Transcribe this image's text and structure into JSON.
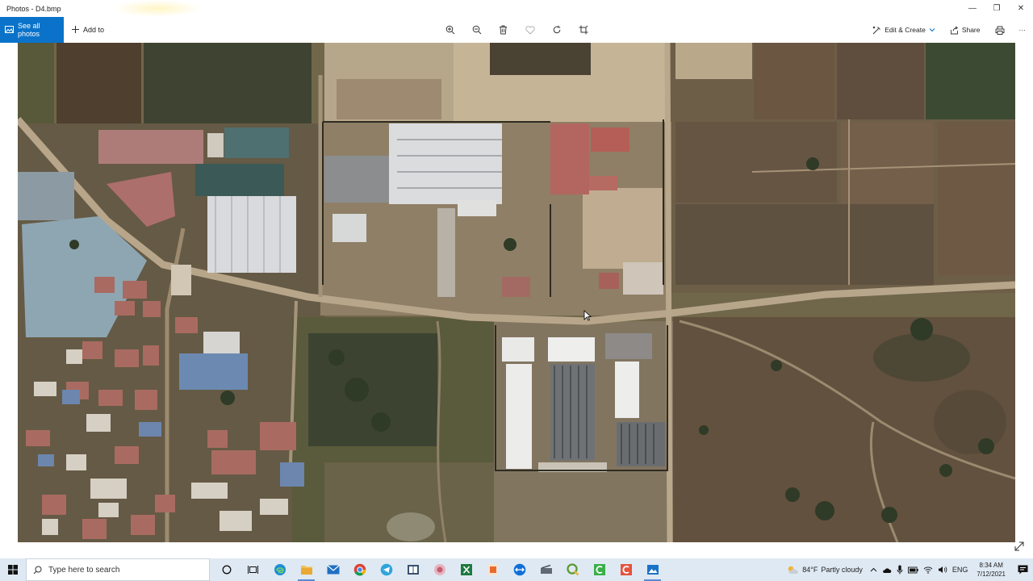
{
  "window": {
    "title": "Photos - D4.bmp",
    "minimize": "—",
    "maximize": "❐",
    "close": "✕"
  },
  "toolbar": {
    "see_all": "See all photos",
    "add_to": "Add to",
    "edit_create": "Edit & Create",
    "share": "Share",
    "more": "···"
  },
  "taskbar": {
    "search_placeholder": "Type here to search",
    "weather_temp": "84°F",
    "weather_text": "Partly cloudy",
    "language": "ENG",
    "time": "8:34 AM",
    "date": "7/12/2021"
  },
  "colors": {
    "accent": "#0a73c9",
    "taskbar": "#dfe9f3"
  }
}
